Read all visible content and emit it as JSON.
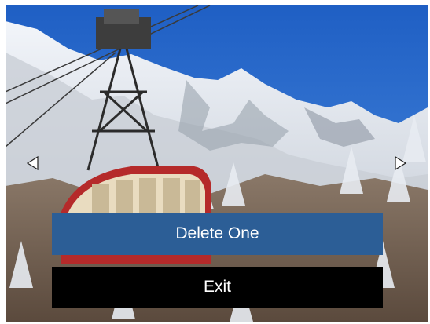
{
  "viewer": {
    "description_icons": {
      "prev": "triangle-left-icon",
      "next": "triangle-right-icon"
    }
  },
  "menu": {
    "delete_one_label": "Delete One",
    "exit_label": "Exit"
  },
  "colors": {
    "delete_button_bg": "#2c5e96",
    "exit_button_bg": "#000000",
    "button_text": "#ffffff",
    "arrow_fill": "#ffffff",
    "arrow_stroke": "#222222"
  }
}
